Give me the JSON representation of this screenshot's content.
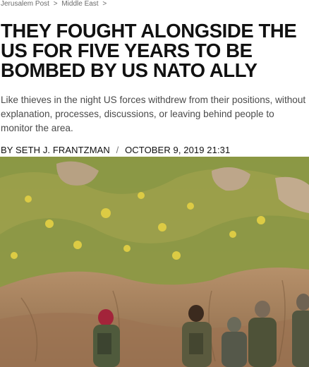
{
  "breadcrumb": {
    "items": [
      "Jerusalem Post",
      "Middle East"
    ],
    "separator": ">"
  },
  "article": {
    "headline": "THEY FOUGHT ALONGSIDE THE US FOR FIVE YEARS TO BE BOMBED BY US NATO ALLY",
    "dek": "Like thieves in the night US forces withdrew from their positions, without explanation, processes, discussions, or leaving behind people to monitor the area.",
    "byline": {
      "prefix": "BY",
      "author": "SETH J. FRANTZMAN",
      "separator": "/",
      "date": "OCTOBER 9, 2019 21:31"
    }
  },
  "colors": {
    "breadcrumb": "#6b6b6b",
    "headline": "#111111",
    "dek": "#4a4a4a",
    "rock": "#b08a62",
    "vegetation": "#8a9a3a",
    "flowers": "#d8c840"
  }
}
